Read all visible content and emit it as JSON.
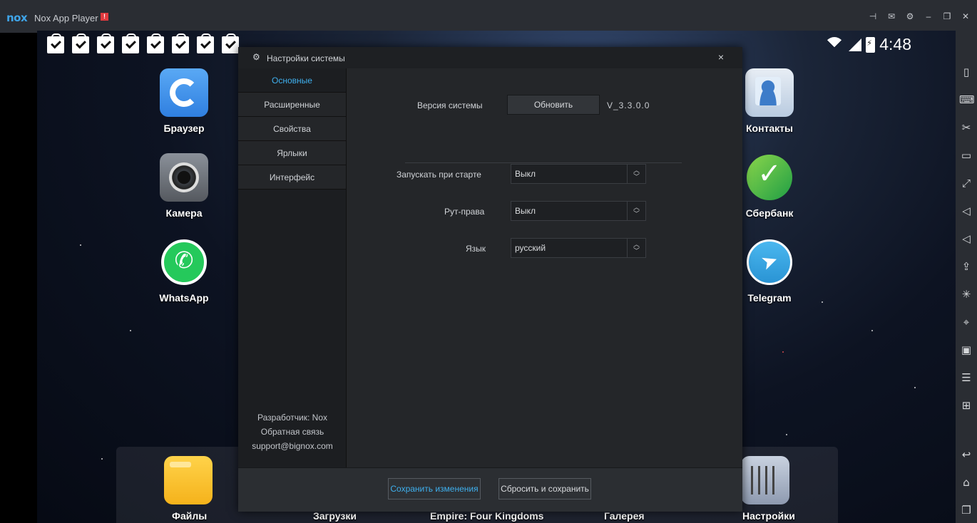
{
  "window": {
    "logo": "nox",
    "app_name": "Nox App Player",
    "alert_badge": "!",
    "title_icons": [
      "pin-icon",
      "mail-icon",
      "gear-icon",
      "minimize-icon",
      "restore-icon",
      "close-icon"
    ]
  },
  "statusbar": {
    "notification_count": 8,
    "time": "4:48"
  },
  "apps": {
    "browser": "Браузер",
    "camera": "Камера",
    "whatsapp": "WhatsApp",
    "contacts": "Контакты",
    "sberbank": "Сбербанк",
    "telegram": "Telegram"
  },
  "dock": {
    "files": "Файлы",
    "downloads": "Загрузки",
    "empire": "Empire: Four Kingdoms",
    "gallery": "Галерея",
    "settings": "Настройки"
  },
  "dialog": {
    "title": "Настройки системы",
    "close": "×",
    "nav": [
      {
        "label": "Основные"
      },
      {
        "label": "Расширенные"
      },
      {
        "label": "Свойства"
      },
      {
        "label": "Ярлыки"
      },
      {
        "label": "Интерфейс"
      }
    ],
    "developer": "Разработчик: Nox",
    "feedback": "Обратная связь",
    "email": "support@bignox.com",
    "version_label": "Версия системы",
    "update_button": "Обновить",
    "version_value": "V_3.3.0.0",
    "autostart_label": "Запускать при старте",
    "autostart_value": "Выкл",
    "root_label": "Рут-права",
    "root_value": "Выкл",
    "language_label": "Язык",
    "language_value": "русский",
    "save_button": "Сохранить изменения",
    "reset_button": "Сбросить и сохранить"
  },
  "colors": {
    "accent": "#3fb0ee",
    "titlebar_bg": "#2a2d33",
    "dialog_bg": "#242629"
  }
}
